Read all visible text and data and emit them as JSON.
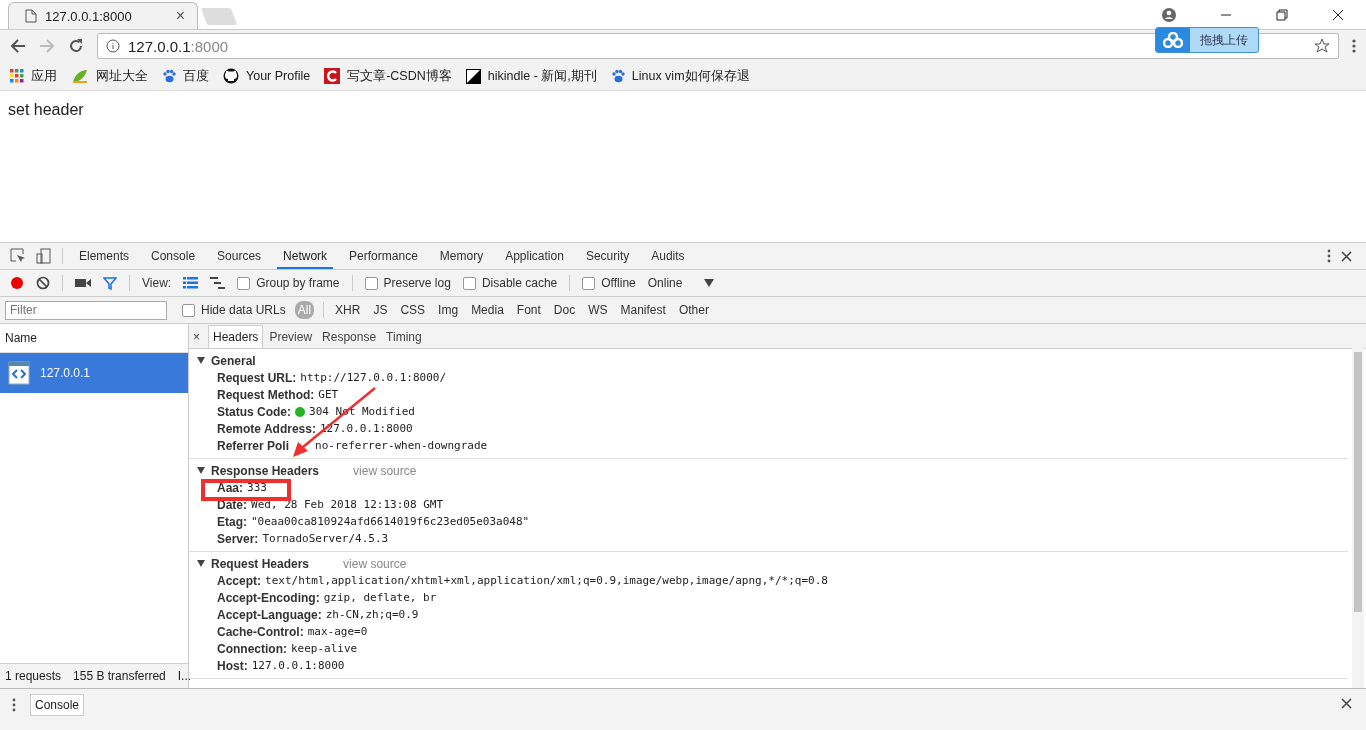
{
  "browser": {
    "tabs": [
      {
        "title": "127.0.0.1:8000",
        "close": "×",
        "selected": true
      }
    ],
    "address": {
      "host": "127.0.0.1",
      "port": ":8000"
    },
    "upload_button": "拖拽上传",
    "bookmarks": [
      {
        "label": "应用",
        "kind": "apps"
      },
      {
        "label": "网址大全",
        "kind": "hao"
      },
      {
        "label": "百度",
        "kind": "paw"
      },
      {
        "label": "Your Profile",
        "kind": "github"
      },
      {
        "label": "写文章-CSDN博客",
        "kind": "csdn"
      },
      {
        "label": "hikindle - 新闻,期刊",
        "kind": "kindle"
      },
      {
        "label": "Linux vim如何保存退",
        "kind": "paw"
      }
    ]
  },
  "page": {
    "text": "set header"
  },
  "devtools": {
    "tabs": [
      {
        "label": "Elements",
        "selected": false
      },
      {
        "label": "Console",
        "selected": false
      },
      {
        "label": "Sources",
        "selected": false
      },
      {
        "label": "Network",
        "selected": true
      },
      {
        "label": "Performance",
        "selected": false
      },
      {
        "label": "Memory",
        "selected": false
      },
      {
        "label": "Application",
        "selected": false
      },
      {
        "label": "Security",
        "selected": false
      },
      {
        "label": "Audits",
        "selected": false
      }
    ],
    "toolbar": {
      "view_label": "View:",
      "options": [
        {
          "label": "Group by frame",
          "checked": false
        },
        {
          "label": "Preserve log",
          "checked": false
        },
        {
          "label": "Disable cache",
          "checked": false
        },
        {
          "label": "Offline",
          "checked": false
        }
      ],
      "throttle": "Online"
    },
    "filter": {
      "placeholder": "Filter",
      "hide_data_urls": {
        "label": "Hide data URLs",
        "checked": false
      },
      "types": [
        {
          "label": "All",
          "selected": true
        },
        {
          "label": "XHR",
          "selected": false
        },
        {
          "label": "JS",
          "selected": false
        },
        {
          "label": "CSS",
          "selected": false
        },
        {
          "label": "Img",
          "selected": false
        },
        {
          "label": "Media",
          "selected": false
        },
        {
          "label": "Font",
          "selected": false
        },
        {
          "label": "Doc",
          "selected": false
        },
        {
          "label": "WS",
          "selected": false
        },
        {
          "label": "Manifest",
          "selected": false
        },
        {
          "label": "Other",
          "selected": false
        }
      ]
    },
    "requests": {
      "column": "Name",
      "rows": [
        {
          "name": "127.0.0.1",
          "selected": true
        }
      ],
      "summary": [
        "1 requests",
        "155 B transferred",
        "I..."
      ]
    },
    "detail": {
      "close": "×",
      "tabs": [
        {
          "label": "Headers",
          "selected": true
        },
        {
          "label": "Preview",
          "selected": false
        },
        {
          "label": "Response",
          "selected": false
        },
        {
          "label": "Timing",
          "selected": false
        }
      ],
      "sections": [
        {
          "title": "General",
          "rows": [
            {
              "key": "Request URL:",
              "value": "http://127.0.0.1:8000/"
            },
            {
              "key": "Request Method:",
              "value": "GET"
            },
            {
              "key": "Status Code:",
              "value": "304 Not Modified",
              "color": "#22b422"
            },
            {
              "key": "Remote Address:",
              "value": "127.0.0.1:8000"
            },
            {
              "key": "Referrer Poli",
              "value": "no-referrer-when-downgrade"
            }
          ]
        },
        {
          "title": "Response Headers",
          "view_source": "view source",
          "rows": [
            {
              "key": "Aaa:",
              "value": "333"
            },
            {
              "key": "Date:",
              "value": "Wed, 28 Feb 2018 12:13:08 GMT"
            },
            {
              "key": "Etag:",
              "value": "\"0eaa00ca810924afd6614019f6c23ed05e03a048\""
            },
            {
              "key": "Server:",
              "value": "TornadoServer/4.5.3"
            }
          ]
        },
        {
          "title": "Request Headers",
          "view_source": "view source",
          "rows": [
            {
              "key": "Accept:",
              "value": "text/html,application/xhtml+xml,application/xml;q=0.9,image/webp,image/apng,*/*;q=0.8"
            },
            {
              "key": "Accept-Encoding:",
              "value": "gzip, deflate, br"
            },
            {
              "key": "Accept-Language:",
              "value": "zh-CN,zh;q=0.9"
            },
            {
              "key": "Cache-Control:",
              "value": "max-age=0"
            },
            {
              "key": "Connection:",
              "value": "keep-alive"
            },
            {
              "key": "Host:",
              "value": "127.0.0.1:8000"
            }
          ]
        }
      ]
    },
    "drawer": {
      "tab": "Console"
    }
  }
}
